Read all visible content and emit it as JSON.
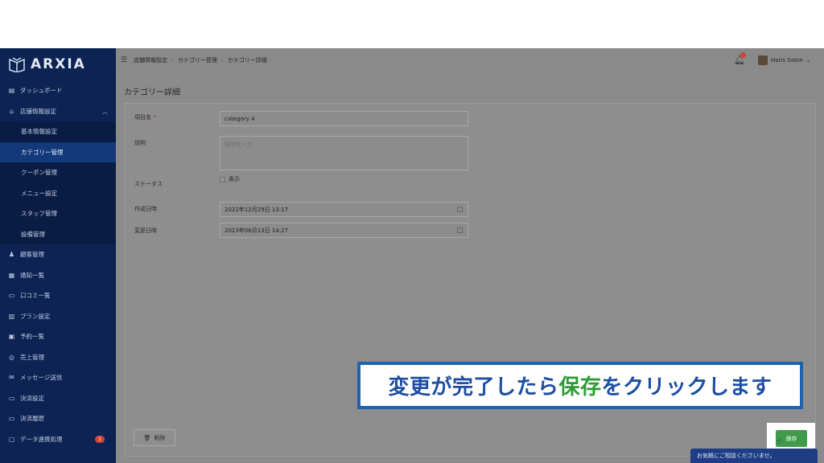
{
  "app": {
    "logo_text": "ARXIA",
    "accent": "#13397a",
    "sidebar_bg": "#0c2353"
  },
  "sidebar": {
    "items": [
      {
        "label": "ダッシュボード",
        "icon": "dashboard-icon"
      },
      {
        "label": "店舗情報設定",
        "icon": "store-icon",
        "expanded": true,
        "children": [
          {
            "label": "基本情報設定"
          },
          {
            "label": "カテゴリー管理",
            "active": true
          },
          {
            "label": "クーポン管理"
          },
          {
            "label": "メニュー設定"
          },
          {
            "label": "スタッフ管理"
          },
          {
            "label": "設備管理"
          }
        ]
      },
      {
        "label": "顧客管理",
        "icon": "customers-icon"
      },
      {
        "label": "通知一覧",
        "icon": "notification-list-icon"
      },
      {
        "label": "口コミ一覧",
        "icon": "review-icon"
      },
      {
        "label": "プラン設定",
        "icon": "plan-icon"
      },
      {
        "label": "予約一覧",
        "icon": "reservation-icon"
      },
      {
        "label": "売上管理",
        "icon": "sales-icon"
      },
      {
        "label": "メッセージ送信",
        "icon": "message-icon"
      },
      {
        "label": "決済設定",
        "icon": "payment-settings-icon"
      },
      {
        "label": "決済履歴",
        "icon": "payment-history-icon"
      },
      {
        "label": "データ連携処理",
        "icon": "data-sync-icon",
        "badge": "1"
      }
    ]
  },
  "header": {
    "breadcrumbs": [
      "店舗情報設定",
      "カテゴリー管理",
      "カテゴリー詳細"
    ],
    "notification_count": "",
    "user_name": "Hairs Salon"
  },
  "page": {
    "title": "カテゴリー詳細",
    "form": {
      "name_label": "項目名",
      "name_required_mark": "*",
      "name_value": "category 4",
      "description_label": "説明",
      "description_placeholder": "説明を入力",
      "status_label": "ステータス",
      "status_option": "表示",
      "created_label": "作成日時",
      "created_value": "2022年12月29日 13:17",
      "updated_label": "変更日時",
      "updated_value": "2023年06月13日 14:27"
    },
    "delete_label": "削除",
    "save_label": "保存",
    "save_color": "#3f9a4c"
  },
  "chat": {
    "label": "お気軽にご相談くださいませ。"
  },
  "caption": {
    "before": "変更が完了したら",
    "highlight": "保存",
    "after": "をクリックします",
    "text_color": "#1d4ea3",
    "highlight_color": "#2e9a35"
  }
}
